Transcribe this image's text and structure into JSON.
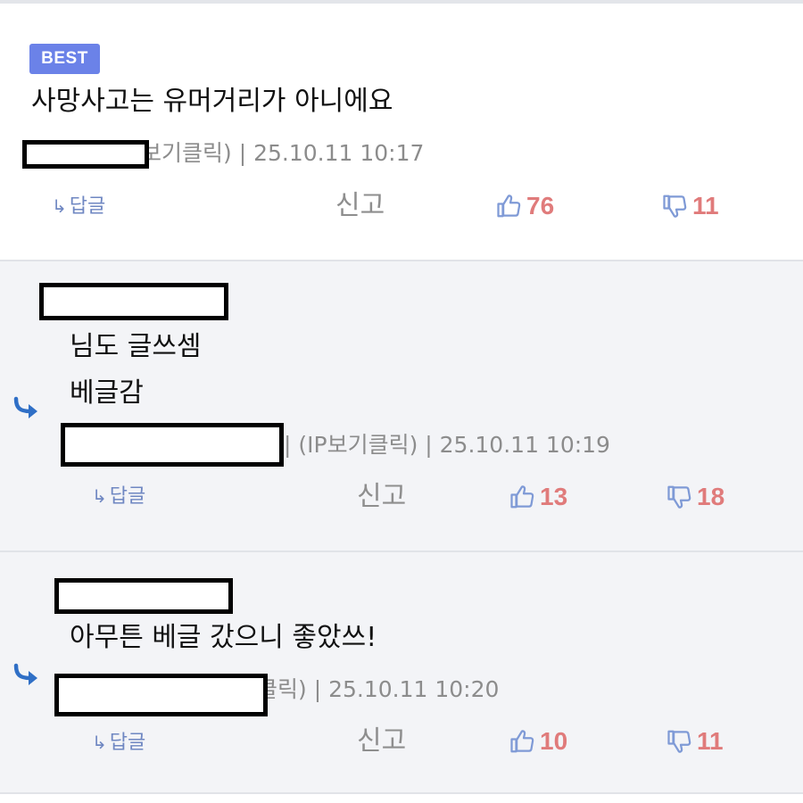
{
  "comments": [
    {
      "badge": "BEST",
      "lines": [
        "사망사고는 유머거리가 아니에요"
      ],
      "meta": "보기클릭) | 25.10.11 10:17",
      "reply_label": "답글",
      "report_label": "신고",
      "likes": "76",
      "dislikes": "11"
    },
    {
      "lines": [
        "님도 글쓰셈",
        "베글감"
      ],
      "meta": "| (IP보기클릭) | 25.10.11 10:19",
      "reply_label": "답글",
      "report_label": "신고",
      "likes": "13",
      "dislikes": "18"
    },
    {
      "lines": [
        "아무튼 베글 갔으니 좋았쓰!"
      ],
      "meta": "클릭) | 25.10.11 10:20",
      "reply_label": "답글",
      "report_label": "신고",
      "likes": "10",
      "dislikes": "11"
    }
  ],
  "icons": {
    "reply_arrow": "reply-arrow-icon",
    "thumbs_up": "thumbs-up-icon",
    "thumbs_down": "thumbs-down-icon"
  },
  "colors": {
    "badge": "#6b82e8",
    "reply_arrow": "#2f6fc6",
    "vote_count": "#e07b7b",
    "vote_icon": "#7f9ad6",
    "reply_link": "#6f87c2"
  }
}
